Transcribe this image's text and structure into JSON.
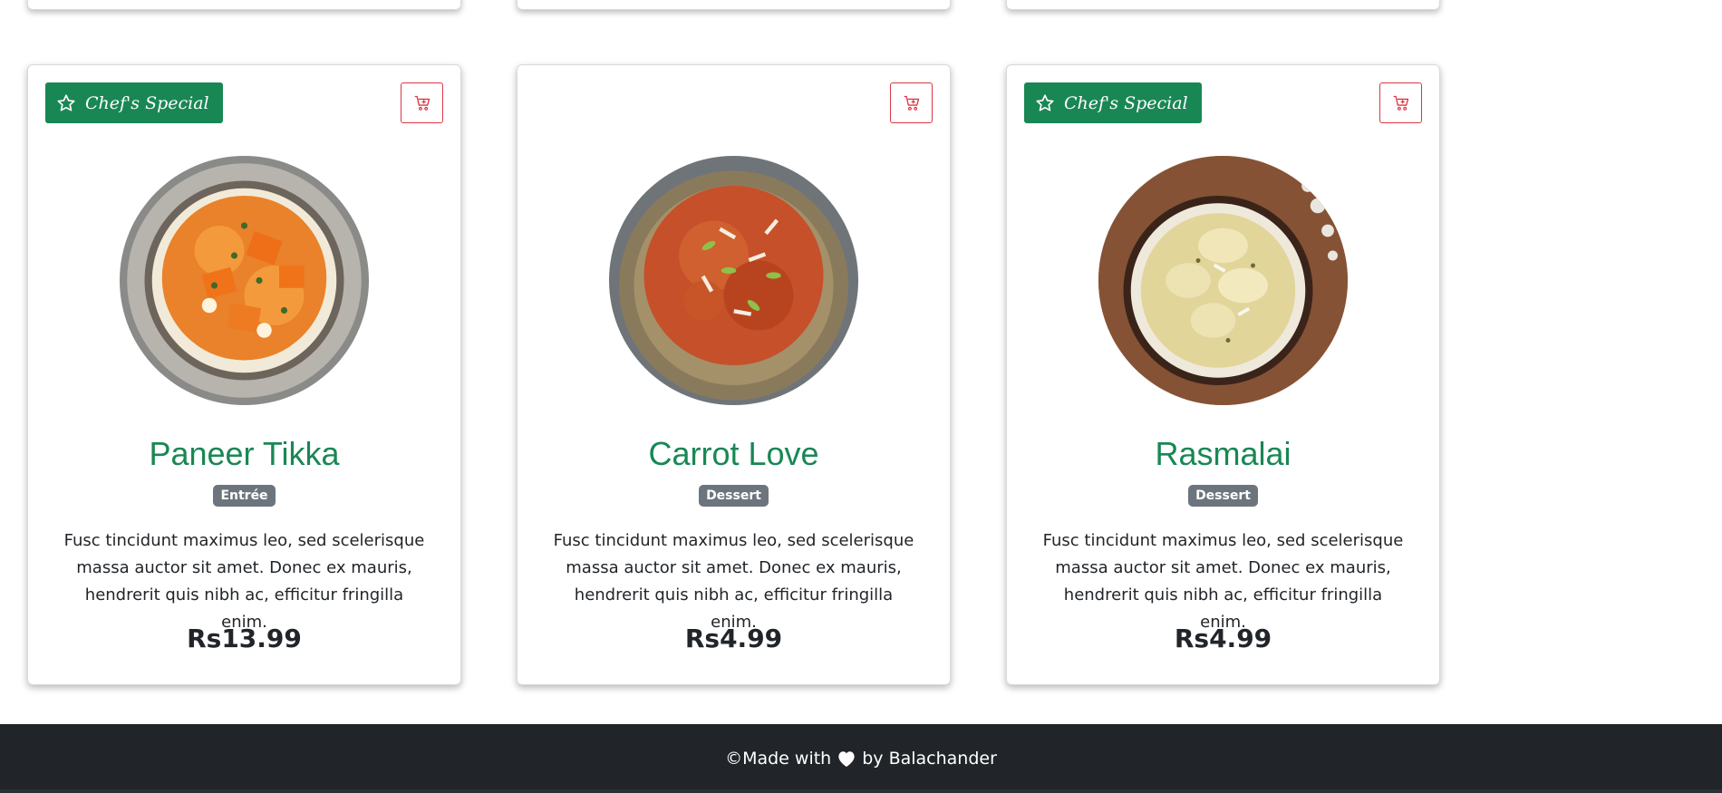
{
  "colors": {
    "accent": "#198754",
    "cart_border": "#dc3545",
    "badge_bg": "#6c757d",
    "footer_bg": "#212529"
  },
  "menu": {
    "cards": [
      {
        "chef_special": true,
        "chef_label": "Chef's Special",
        "title": "Paneer Tikka",
        "category": "Entrée",
        "description": "Fusc tincidunt maximus leo, sed scelerisque massa auctor sit amet. Donec ex mauris, hendrerit quis nibh ac, efficitur fringilla enim.",
        "price": "Rs13.99",
        "icon": "cart-plus-icon"
      },
      {
        "chef_special": false,
        "chef_label": "",
        "title": "Carrot Love",
        "category": "Dessert",
        "description": "Fusc tincidunt maximus leo, sed scelerisque massa auctor sit amet. Donec ex mauris, hendrerit quis nibh ac, efficitur fringilla enim.",
        "price": "Rs4.99",
        "icon": "cart-plus-icon"
      },
      {
        "chef_special": true,
        "chef_label": "Chef's Special",
        "title": "Rasmalai",
        "category": "Dessert",
        "description": "Fusc tincidunt maximus leo, sed scelerisque massa auctor sit amet. Donec ex mauris, hendrerit quis nibh ac, efficitur fringilla enim.",
        "price": "Rs4.99",
        "icon": "cart-plus-icon"
      }
    ]
  },
  "footer": {
    "prefix": "©Made with",
    "suffix": "by Balachander",
    "icon": "heart-icon"
  }
}
